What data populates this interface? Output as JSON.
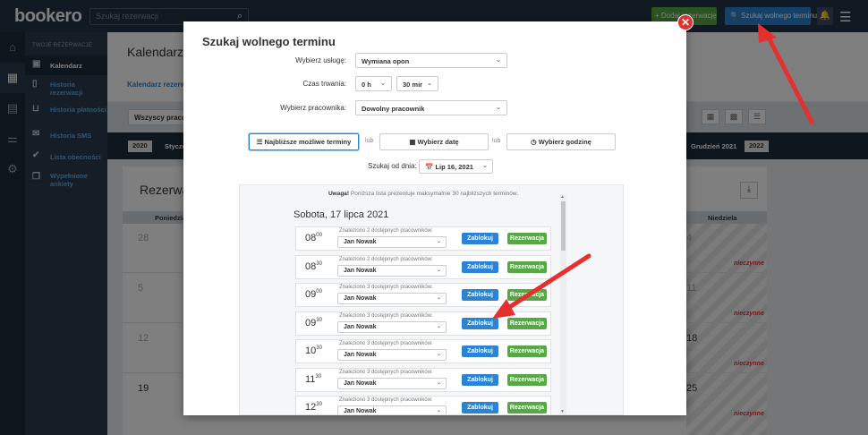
{
  "app": {
    "logo": "bookero"
  },
  "topbar": {
    "search_placeholder": "Szukaj rezerwacji",
    "add_reservation": "+ Dodaj rezerwację",
    "find_slot": "🔍 Szukaj wolnego terminu"
  },
  "sidebar": {
    "section": "TWOJE REZERWACJE",
    "items": [
      {
        "label": "Kalendarz",
        "icon": "calendar-icon"
      },
      {
        "label": "Historia rezerwacji",
        "icon": "bookmark-icon"
      },
      {
        "label": "Historia płatności",
        "icon": "basket-icon"
      },
      {
        "label": "Historia SMS",
        "icon": "envelope-icon"
      },
      {
        "label": "Lista obecności",
        "icon": "check-icon"
      },
      {
        "label": "Wypełnione ankiety",
        "icon": "copy-icon"
      }
    ]
  },
  "main": {
    "title": "Kalendarz re",
    "tab": "Kalendarz rezerwa",
    "filter_button": "Wszyscy pracowni",
    "timeline": {
      "year_left": "2020",
      "month_left": "Styczeń",
      "month_right": "Grudzień 2021",
      "year_right": "2022"
    },
    "calendar_title": "Rezerwac",
    "col_first": "Poniedział",
    "col_last": "Niedziela",
    "day_numbers_left": [
      "28",
      "5",
      "12",
      "19"
    ],
    "day_numbers_right": [
      "4",
      "11",
      "18",
      "25"
    ],
    "closed_label": "nieczynne"
  },
  "modal": {
    "title": "Szukaj wolnego terminu",
    "service_label": "Wybierz usługę:",
    "service_value": "Wymiana opon",
    "duration_label": "Czas trwania:",
    "duration_hours": "0 h",
    "duration_minutes": "30 mir",
    "worker_label": "Wybierz pracownika:",
    "worker_value": "Dowolny pracownik",
    "options": [
      "☰ Najbliższe możliwe terminy",
      "▦ Wybierz datę",
      "◷ Wybierz godzinę"
    ],
    "or": "lub",
    "from_day_label": "Szukaj od dnia:",
    "from_day_value": "📅 Lip 16, 2021",
    "note_bold": "Uwaga!",
    "note_text": "Poniższa lista prezentuje maksymalnie 30 najbliższych terminów.",
    "day_heading": "Sobota, 17 lipca 2021",
    "slots": [
      {
        "hour": "08",
        "min": "00",
        "found": "Znaleziono 2 dostępnych pracowników:"
      },
      {
        "hour": "08",
        "min": "30",
        "found": "Znaleziono 2 dostępnych pracowników:"
      },
      {
        "hour": "09",
        "min": "00",
        "found": "Znaleziono 3 dostępnych pracowników:"
      },
      {
        "hour": "09",
        "min": "30",
        "found": "Znaleziono 3 dostępnych pracowników:"
      },
      {
        "hour": "10",
        "min": "30",
        "found": "Znaleziono 3 dostępnych pracowników:"
      },
      {
        "hour": "11",
        "min": "30",
        "found": "Znaleziono 3 dostępnych pracowników:"
      },
      {
        "hour": "12",
        "min": "30",
        "found": "Znaleziono 3 dostępnych pracowników:"
      }
    ],
    "employee": "Jan Nowak",
    "block_label": "Zablokuj",
    "reserve_label": "Rezerwacja"
  },
  "colors": {
    "primary": "#2b83d1",
    "success": "#56a845",
    "danger": "#e03131",
    "topbar": "#233445"
  }
}
